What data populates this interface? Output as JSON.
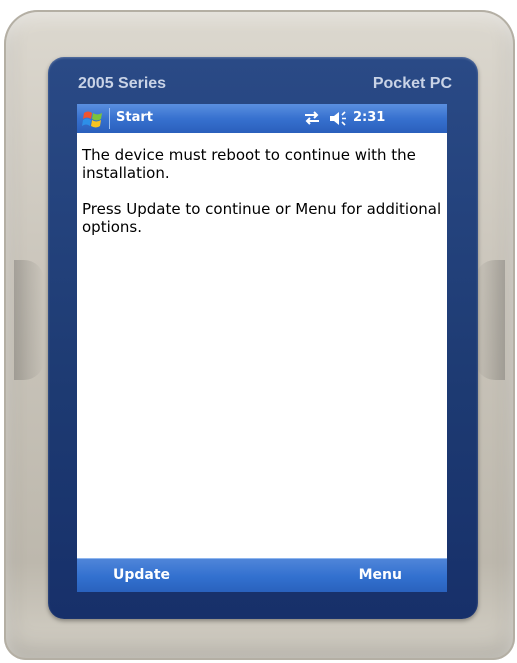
{
  "device": {
    "series_label": "2005 Series",
    "brand_label": "Pocket PC"
  },
  "titlebar": {
    "start_label": "Start",
    "time": "2:31",
    "start_icon": "windows-flag-icon",
    "connectivity_icon": "connectivity-icon",
    "volume_icon": "speaker-volume-icon"
  },
  "content": {
    "message_line": "The device must reboot to continue with the installation.",
    "instruction_line": "Press Update to continue or Menu for additional options."
  },
  "softkeys": {
    "left_label": "Update",
    "right_label": "Menu"
  },
  "colors": {
    "titlebar_blue": "#3771cf",
    "softbar_blue": "#3270cf",
    "bezel_navy": "#1d3a72"
  }
}
